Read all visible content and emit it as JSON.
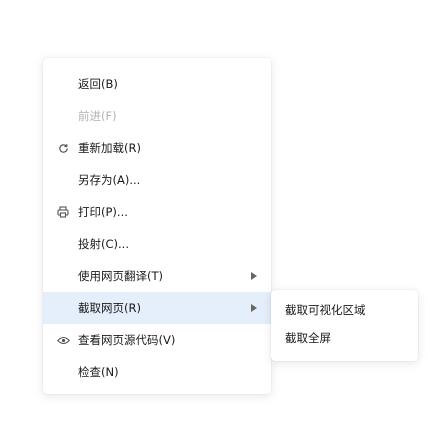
{
  "context_menu": {
    "items": [
      {
        "label": "返回(B)",
        "disabled": false,
        "icon": null,
        "has_submenu": false
      },
      {
        "label": "前进(F)",
        "disabled": true,
        "icon": null,
        "has_submenu": false
      },
      {
        "label": "重新加载(R)",
        "disabled": false,
        "icon": "reload-icon",
        "has_submenu": false
      },
      {
        "label": "另存为(A)...",
        "disabled": false,
        "icon": null,
        "has_submenu": false
      },
      {
        "label": "打印(P)...",
        "disabled": false,
        "icon": "print-icon",
        "has_submenu": false
      },
      {
        "label": "投射(C)...",
        "disabled": false,
        "icon": null,
        "has_submenu": false
      },
      {
        "label": "使用网页翻译(T)",
        "disabled": false,
        "icon": null,
        "has_submenu": true
      },
      {
        "label": "截取网页(R)",
        "disabled": false,
        "icon": null,
        "has_submenu": true,
        "highlighted": true
      },
      {
        "label": "查看网页源代码(V)",
        "disabled": false,
        "icon": "eye-icon",
        "has_submenu": false
      },
      {
        "label": "检查(N)",
        "disabled": false,
        "icon": null,
        "has_submenu": false
      }
    ]
  },
  "submenu": {
    "items": [
      {
        "label": "截取可视化区域"
      },
      {
        "label": "截取全屏"
      }
    ]
  },
  "colors": {
    "highlight_bg": "#e5eefb",
    "text": "#1a1a1a",
    "disabled_text": "#b3b3b3"
  }
}
